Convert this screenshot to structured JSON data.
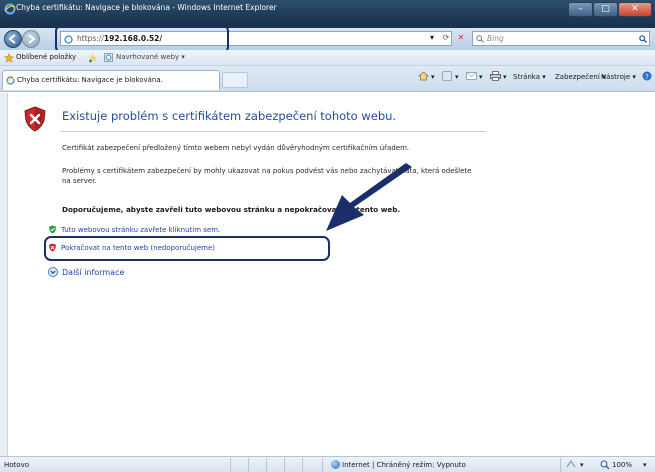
{
  "window": {
    "title": "Chyba certifikátu: Navigace je blokována - Windows Internet Explorer",
    "min_glyph": "–",
    "max_glyph": "□",
    "close_glyph": "✕"
  },
  "navigation": {
    "address_scheme": "https://",
    "address_host": "192.168.0.52/",
    "address_dropdown_glyph": "▾",
    "refresh_glyph": "⟳",
    "stop_glyph": "✕",
    "search_placeholder": "Bing"
  },
  "favorites": {
    "label": "Oblíbené položky",
    "suggested_sites": "Navrhované weby ▾"
  },
  "tab": {
    "label": "Chyba certifikátu: Navigace je blokována."
  },
  "commandbar": {
    "home": "▾",
    "feeds": "▾",
    "mail": "▾",
    "page": "Stránka ▾",
    "safety": "Zabezpečení ▾",
    "tools": "Nástroje ▾",
    "help": "▾"
  },
  "content": {
    "heading": "Existuje problém s certifikátem zabezpečení tohoto webu.",
    "paragraph1": "Certifikát zabezpečení předložený tímto webem nebyl vydán důvěryhodným certifikačním úřadem.",
    "paragraph2": "Problémy s certifikátem zabezpečení by mohly ukazovat na pokus podvést vás nebo zachytávat data, která odešlete na server.",
    "recommendation": "Doporučujeme, abyste zavřeli tuto webovou stránku a nepokračovali na tento web.",
    "close_link": "Tuto webovou stránku zavřete kliknutím sem.",
    "continue_link": "Pokračovat na tento web (nedoporučujeme)",
    "more_info": "Další informace"
  },
  "statusbar": {
    "status": "Hotovo",
    "zone": "Internet | Chráněný režim: Vypnuto",
    "zoom": "100%"
  },
  "colors": {
    "heading": "#1f4e9a",
    "link": "#1c47a3",
    "annotation": "#1b2d6b",
    "titlebar": "#1e3a55"
  }
}
